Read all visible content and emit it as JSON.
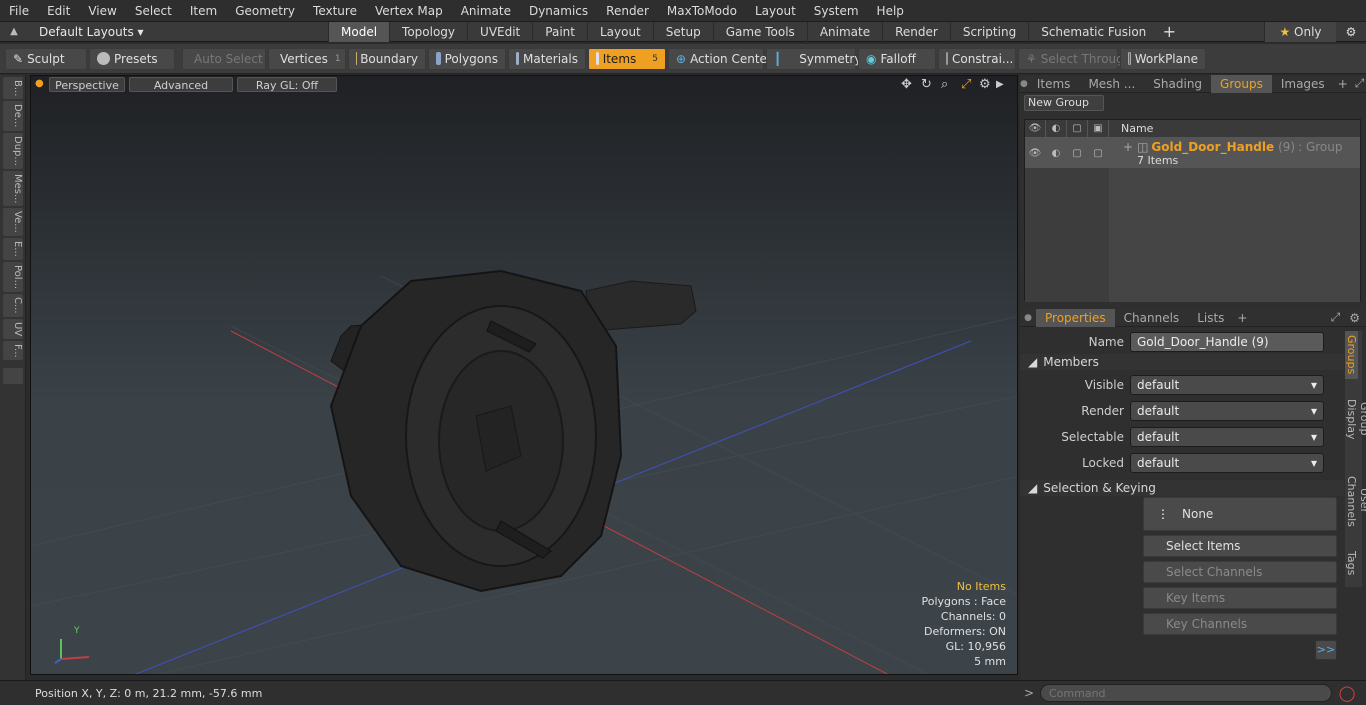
{
  "menu": [
    "File",
    "Edit",
    "View",
    "Select",
    "Item",
    "Geometry",
    "Texture",
    "Vertex Map",
    "Animate",
    "Dynamics",
    "Render",
    "MaxToModo",
    "Layout",
    "System",
    "Help"
  ],
  "layout": {
    "dropdown": "Default Layouts ▾",
    "tabs": [
      "Model",
      "Topology",
      "UVEdit",
      "Paint",
      "Layout",
      "Setup",
      "Game Tools",
      "Animate",
      "Render",
      "Scripting",
      "Schematic Fusion"
    ],
    "active_tab": "Model",
    "only_label": "Only"
  },
  "toolbar": {
    "sculpt": "Sculpt",
    "presets": "Presets",
    "auto_select": "Auto Select",
    "vertices": "Vertices",
    "vertices_count": "1",
    "boundary": "Boundary",
    "polygons": "Polygons",
    "materials": "Materials",
    "items": "Items",
    "items_count": "5",
    "action_center": "Action Center",
    "symmetry": "Symmetry",
    "falloff": "Falloff",
    "constraints": "Constrai...",
    "select_through": "Select Through",
    "workplane": "WorkPlane"
  },
  "left_tabs": [
    "B...",
    "De...",
    "Dup...",
    "Mes...",
    "Ve...",
    "E...",
    "Pol...",
    "C...",
    "UV",
    "F..."
  ],
  "viewport": {
    "perspective": "Perspective",
    "advanced": "Advanced",
    "raygl": "Ray GL: Off",
    "stats": {
      "no_items": "No Items",
      "polygons": "Polygons : Face",
      "channels": "Channels: 0",
      "deformers": "Deformers: ON",
      "gl": "GL: 10,956",
      "scale": "5 mm"
    },
    "axis_y": "Y"
  },
  "right_top": {
    "tabs": [
      "Items",
      "Mesh ...",
      "Shading",
      "Groups",
      "Images"
    ],
    "active_tab": "Groups",
    "new_group": "New Group",
    "name_header": "Name",
    "group_name": "Gold_Door_Handle",
    "group_count": "(9)",
    "group_type": ": Group",
    "group_items": "7 Items"
  },
  "properties": {
    "tabs": [
      "Properties",
      "Channels",
      "Lists"
    ],
    "active_tab": "Properties",
    "name_label": "Name",
    "name_value": "Gold_Door_Handle (9)",
    "members_header": "Members",
    "visible_label": "Visible",
    "visible_value": "default",
    "render_label": "Render",
    "render_value": "default",
    "selectable_label": "Selectable",
    "selectable_value": "default",
    "locked_label": "Locked",
    "locked_value": "default",
    "sel_key_header": "Selection & Keying",
    "none_label": "None",
    "select_items": "Select Items",
    "select_channels": "Select Channels",
    "key_items": "Key Items",
    "key_channels": "Key Channels",
    "more": ">>",
    "side_tabs": [
      "Groups",
      "Group Display",
      "User Channels",
      "Tags"
    ],
    "side_active": "Groups"
  },
  "status": {
    "position": "Position X, Y, Z:   0 m, 21.2 mm, -57.6 mm",
    "command_placeholder": "Command"
  },
  "colors": {
    "accent": "#f0a020"
  }
}
